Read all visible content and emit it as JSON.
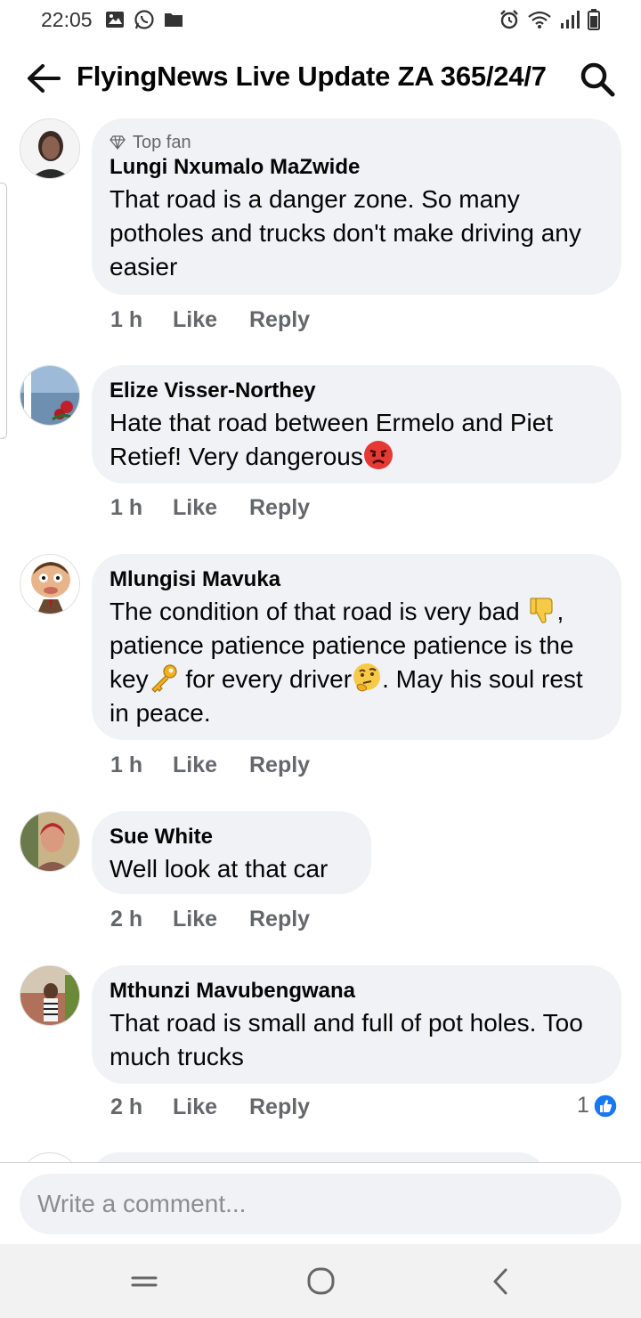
{
  "status_bar": {
    "time": "22:05",
    "left_icons": [
      "image-icon",
      "whatsapp-icon",
      "folder-icon"
    ],
    "right_icons": [
      "alarm-icon",
      "wifi-icon",
      "signal-icon",
      "battery-icon"
    ]
  },
  "header": {
    "title": "FlyingNews Live Update ZA 365/24/7",
    "back_icon": "arrow-left-icon",
    "search_icon": "search-icon"
  },
  "comments": [
    {
      "badge": "Top fan",
      "author": "Lungi Nxumalo MaZwide",
      "text": "That road is a danger zone. So many potholes and trucks don't make driving any easier",
      "time": "1 h",
      "like": "Like",
      "reply": "Reply"
    },
    {
      "author": "Elize Visser-Northey",
      "text": "Hate that road between Ermelo and Piet Retief! Very dangerous",
      "emoji_end": "angry-face-emoji",
      "time": "1 h",
      "like": "Like",
      "reply": "Reply"
    },
    {
      "author": "Mlungisi Mavuka",
      "text_parts": [
        "The condition of that road is very bad ",
        ", patience patience patience patience is the key",
        " for every driver",
        ". May his soul rest in peace."
      ],
      "emojis": [
        "thumbs-down-emoji",
        "key-emoji",
        "thinking-face-emoji"
      ],
      "time": "1 h",
      "like": "Like",
      "reply": "Reply"
    },
    {
      "author": "Sue White",
      "text": "Well look at that car",
      "time": "2 h",
      "like": "Like",
      "reply": "Reply"
    },
    {
      "author": "Mthunzi Mavubengwana",
      "text": "That road is small and full of pot holes. Too much trucks",
      "time": "2 h",
      "like": "Like",
      "reply": "Reply",
      "reaction_count": "1",
      "reaction_icon": "like-reaction-icon"
    }
  ],
  "composer": {
    "placeholder": "Write a comment..."
  },
  "nav_bar": {
    "buttons": [
      "recents-icon",
      "home-icon",
      "back-icon"
    ]
  },
  "colors": {
    "bubble": "#f0f2f5",
    "secondary_text": "#65676b",
    "like_blue": "#1877f2"
  }
}
